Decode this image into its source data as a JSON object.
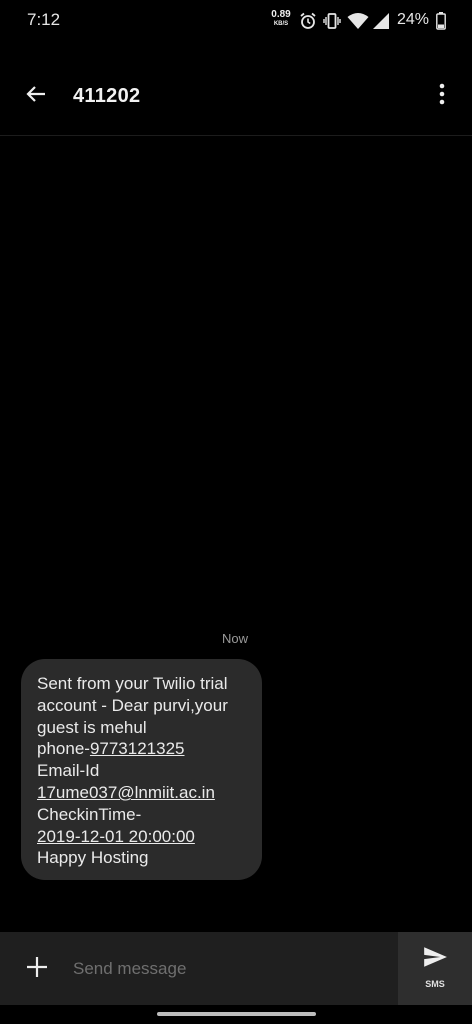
{
  "status_bar": {
    "time": "7:12",
    "net_speed": "0.89",
    "net_unit": "KB/S",
    "battery": "24%",
    "icons": [
      "alarm-icon",
      "vibrate-icon",
      "wifi-icon",
      "cell-signal-icon",
      "battery-icon"
    ]
  },
  "header": {
    "title": "411202",
    "back_icon": "arrow-back-icon",
    "menu_icon": "more-vert-icon"
  },
  "thread": {
    "timestamp": "Now",
    "message": {
      "lines": [
        "Sent from your Twilio trial",
        "account - Dear purvi,your",
        "guest is mehul"
      ],
      "phone_prefix": "phone-",
      "phone": "9773121325",
      "email_label": "Email-Id",
      "email": "17ume037@lnmiit.ac.in",
      "checkin_label": "CheckinTime-",
      "checkin_value": "2019-12-01 20:00:00",
      "closing": "Happy Hosting"
    }
  },
  "compose": {
    "placeholder": "Send message",
    "send_label": "SMS",
    "add_icon": "plus-icon",
    "send_icon": "send-icon"
  },
  "colors": {
    "background": "#000000",
    "bubble": "#2b2b2b",
    "compose_bar": "#1f1f1f",
    "send_button": "#2e2e2e"
  }
}
